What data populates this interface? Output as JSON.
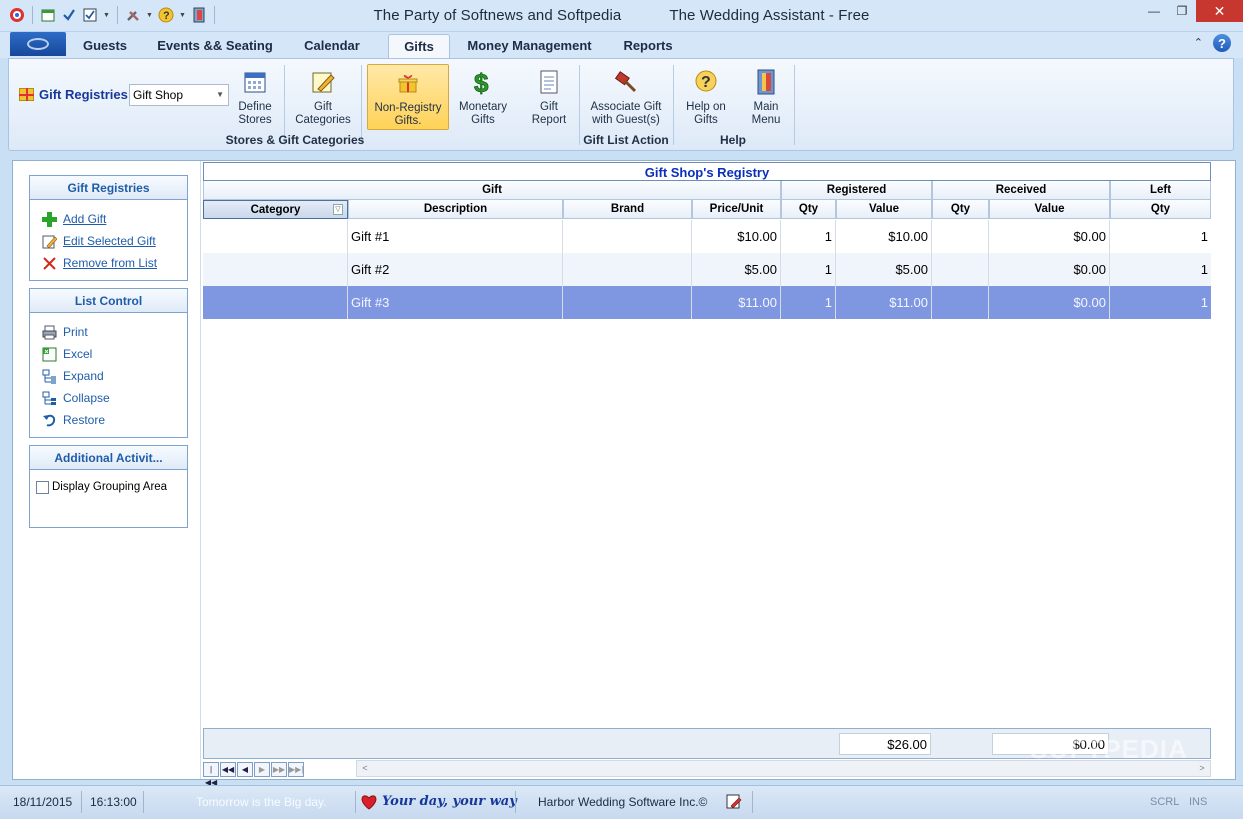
{
  "window": {
    "title_left": "The Party of Softnews and Softpedia",
    "title_right": "The Wedding Assistant - Free",
    "close_icon": "close-icon"
  },
  "tabs": [
    {
      "label": "Guests"
    },
    {
      "label": "Events && Seating"
    },
    {
      "label": "Calendar"
    },
    {
      "label": "Gifts"
    },
    {
      "label": "Money Management"
    },
    {
      "label": "Reports"
    }
  ],
  "ribbon": {
    "registry_label": "Gift Registries",
    "registry_value": "Gift Shop",
    "buttons": [
      {
        "label": "Define Stores"
      },
      {
        "label": "Gift Categories"
      },
      {
        "label": "Non-Registry Gifts."
      },
      {
        "label": "Monetary Gifts"
      },
      {
        "label": "Gift Report"
      },
      {
        "label": "Associate Gift with Guest(s)"
      },
      {
        "label": "Help on Gifts"
      },
      {
        "label": "Main Menu"
      }
    ],
    "groups": [
      {
        "label": "Stores & Gift Categories"
      },
      {
        "label": "Gift List Action"
      },
      {
        "label": "Help"
      }
    ]
  },
  "sidebar": {
    "registries": {
      "title": "Gift Registries",
      "items": [
        {
          "label": "Add Gift"
        },
        {
          "label": "Edit Selected Gift"
        },
        {
          "label": "Remove from List"
        }
      ]
    },
    "list_control": {
      "title": "List Control",
      "items": [
        {
          "label": "Print"
        },
        {
          "label": "Excel"
        },
        {
          "label": "Expand"
        },
        {
          "label": "Collapse"
        },
        {
          "label": "Restore"
        }
      ]
    },
    "additional": {
      "title": "Additional Activit...",
      "checkbox_label": "Display Grouping Area"
    }
  },
  "grid": {
    "title": "Gift Shop's Registry",
    "bands": [
      "Gift",
      "Registered",
      "Received",
      "Left"
    ],
    "columns": [
      "Category",
      "Description",
      "Brand",
      "Price/Unit",
      "Qty",
      "Value",
      "Qty",
      "Value",
      "Qty"
    ],
    "rows": [
      {
        "category": "",
        "description": "Gift #1",
        "brand": "",
        "price": "$10.00",
        "reg_qty": "1",
        "reg_value": "$10.00",
        "rec_qty": "",
        "rec_value": "$0.00",
        "left_qty": "1"
      },
      {
        "category": "",
        "description": "Gift #2",
        "brand": "",
        "price": "$5.00",
        "reg_qty": "1",
        "reg_value": "$5.00",
        "rec_qty": "",
        "rec_value": "$0.00",
        "left_qty": "1"
      },
      {
        "category": "",
        "description": "Gift #3",
        "brand": "",
        "price": "$11.00",
        "reg_qty": "1",
        "reg_value": "$11.00",
        "rec_qty": "",
        "rec_value": "$0.00",
        "left_qty": "1"
      }
    ],
    "selected_row": 2,
    "totals": {
      "registered_value": "$26.00",
      "received_value": "$0.00"
    }
  },
  "status": {
    "date": "18/11/2015",
    "time": "16:13:00",
    "message": "Tomorrow is the Big day.",
    "slogan": "Your day, your way",
    "company": "Harbor Wedding Software Inc.©",
    "scrl": "SCRL",
    "ins": "INS"
  },
  "watermark": "SOFTPEDIA",
  "colors": {
    "accent": "#1f5da8",
    "selected_row": "#7e97e0",
    "title_blue": "#0a2fbb",
    "active_button": "#ffd257"
  }
}
